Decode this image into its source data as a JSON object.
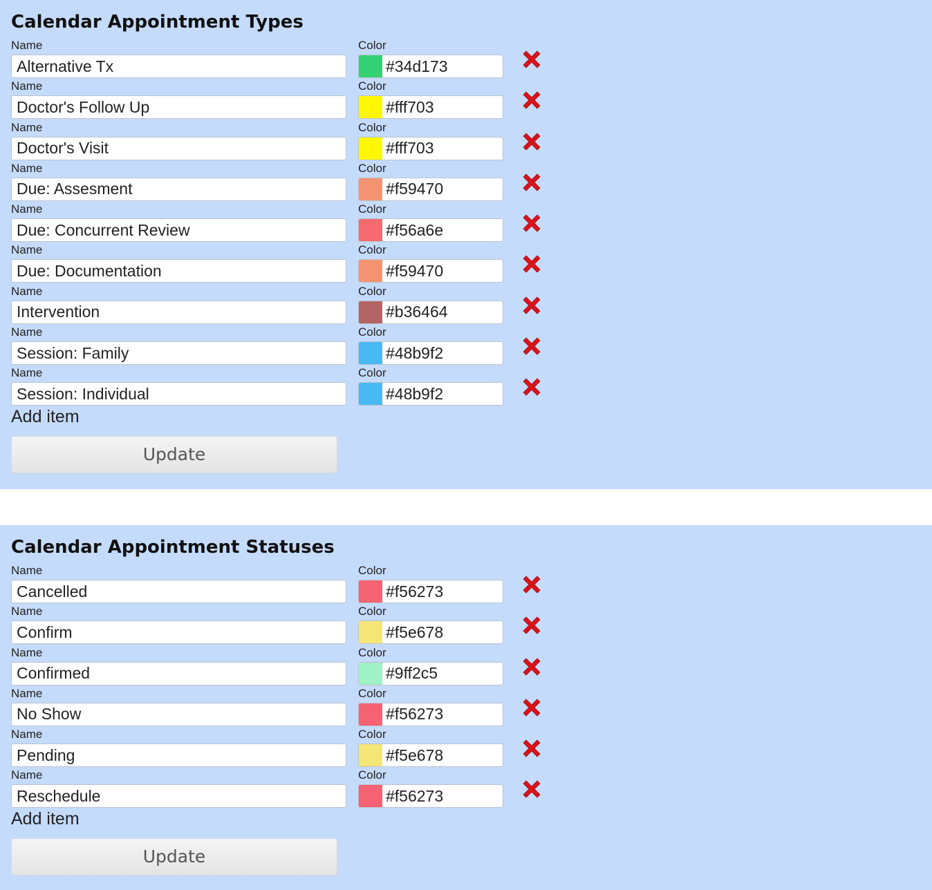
{
  "sections": [
    {
      "title": "Calendar Appointment Types",
      "name_label": "Name",
      "color_label": "Color",
      "add_item_label": "Add item",
      "update_label": "Update",
      "items": [
        {
          "name": "Alternative Tx",
          "color": "#34d173"
        },
        {
          "name": "Doctor's Follow Up",
          "color": "#fff703"
        },
        {
          "name": "Doctor's Visit",
          "color": "#fff703"
        },
        {
          "name": "Due: Assesment",
          "color": "#f59470"
        },
        {
          "name": "Due: Concurrent Review",
          "color": "#f56a6e"
        },
        {
          "name": "Due: Documentation",
          "color": "#f59470"
        },
        {
          "name": "Intervention",
          "color": "#b36464"
        },
        {
          "name": "Session: Family",
          "color": "#48b9f2"
        },
        {
          "name": "Session: Individual",
          "color": "#48b9f2"
        }
      ]
    },
    {
      "title": "Calendar Appointment Statuses",
      "name_label": "Name",
      "color_label": "Color",
      "add_item_label": "Add item",
      "update_label": "Update",
      "items": [
        {
          "name": "Cancelled",
          "color": "#f56273"
        },
        {
          "name": "Confirm",
          "color": "#f5e678"
        },
        {
          "name": "Confirmed",
          "color": "#9ff2c5"
        },
        {
          "name": "No Show",
          "color": "#f56273"
        },
        {
          "name": "Pending",
          "color": "#f5e678"
        },
        {
          "name": "Reschedule",
          "color": "#f56273"
        }
      ]
    }
  ],
  "theme": {
    "panel_background": "#c5dbfc",
    "delete_icon_color": "#d8141b"
  },
  "icons": {
    "delete": "close-x-icon"
  }
}
